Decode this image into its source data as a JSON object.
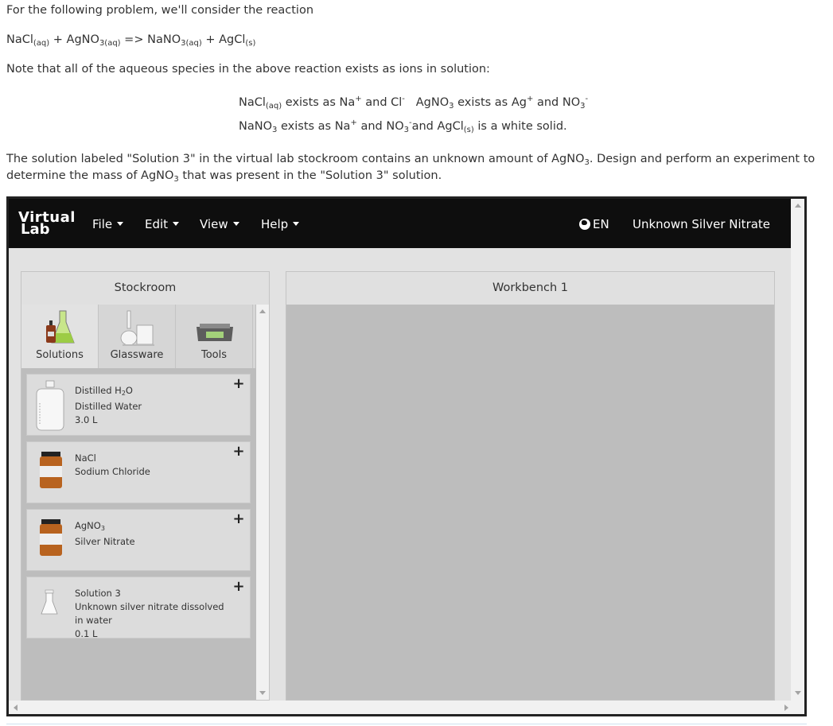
{
  "problem": {
    "intro": "For the following problem, we'll consider the reaction",
    "reaction": {
      "r1": "NaCl",
      "r1_state": "(aq)",
      "plus1": " + ",
      "r2": "AgNO",
      "r2_sub": "3(aq)",
      "arrow": " => ",
      "p1": "NaNO",
      "p1_sub": "3(aq)",
      "plus2": " + ",
      "p2": "AgCl",
      "p2_state": "(s)"
    },
    "note": "Note that all of the aqueous species in the above reaction exists as ions in solution:",
    "line1": {
      "a": "NaCl",
      "a_state": "(aq)",
      "b": " exists as Na",
      "b_sup": "+",
      "c": " and Cl",
      "c_sup": "-",
      "d": "   AgNO",
      "d_sub": "3",
      "e": " exists as Ag",
      "e_sup": "+",
      "f": " and NO",
      "f_sub": "3",
      "f_sup": "-"
    },
    "line2": {
      "a": "NaNO",
      "a_sub": "3",
      "b": " exists as Na",
      "b_sup": "+",
      "c": " and NO",
      "c_sub": "3",
      "c_sup": "-",
      "d": "and AgCl",
      "d_state": "(s)",
      "e": " is a white solid."
    },
    "task_l1": "The solution labeled \"Solution 3\" in the virtual lab stockroom contains an unknown amount of AgNO",
    "task_l1_sub": "3",
    "task_l1_end": ". Design and perform an experiment to",
    "task_l2": "determine the mass of AgNO",
    "task_l2_sub": "3",
    "task_l2_end": " that was present in the \"Solution 3\" solution."
  },
  "app": {
    "logo_top": "Virtual",
    "logo_bottom": "Lab",
    "menus": [
      "File",
      "Edit",
      "View",
      "Help"
    ],
    "language": "EN",
    "assignment_title": "Unknown Silver Nitrate",
    "colors": {
      "nav_bg": "#0e0e0e",
      "panel_bg": "#bdbdbd",
      "frame_bg": "#e2e2e2"
    }
  },
  "stockroom": {
    "title": "Stockroom",
    "tabs": [
      {
        "label": "Solutions",
        "icon": "solutions-icon",
        "active": true
      },
      {
        "label": "Glassware",
        "icon": "glassware-icon",
        "active": false
      },
      {
        "label": "Tools",
        "icon": "balance-icon",
        "active": false
      }
    ],
    "items": [
      {
        "formula": "Distilled H",
        "formula_sub": "2",
        "formula_end": "O",
        "name": "Distilled Water",
        "amount": "3.0 L",
        "icon": "water-carboy-icon"
      },
      {
        "formula": "NaCl",
        "formula_sub": "",
        "formula_end": "",
        "name": "Sodium Chloride",
        "amount": "",
        "icon": "reagent-bottle-icon"
      },
      {
        "formula": "AgNO",
        "formula_sub": "3",
        "formula_end": "",
        "name": "Silver Nitrate",
        "amount": "",
        "icon": "reagent-bottle-icon"
      },
      {
        "formula": "Solution 3",
        "formula_sub": "",
        "formula_end": "",
        "name": "Unknown silver nitrate dissolved in water",
        "amount": "0.1 L",
        "icon": "flask-icon"
      }
    ],
    "add_symbol": "+"
  },
  "workbench": {
    "title": "Workbench 1"
  }
}
